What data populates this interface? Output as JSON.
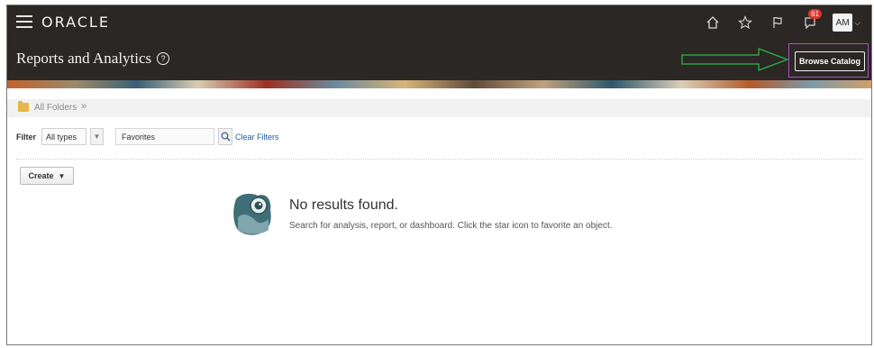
{
  "header": {
    "logo": "ORACLE",
    "page_title": "Reports and Analytics",
    "notification_count": "61",
    "avatar_initials": "AM",
    "icons": [
      "menu-icon",
      "home-icon",
      "star-icon",
      "flag-icon",
      "notifications-icon",
      "help-icon"
    ],
    "browse_catalog_label": "Browse Catalog",
    "bar_color": "#2b2724"
  },
  "breadcrumb": {
    "label": "All Folders",
    "separator": "»"
  },
  "filter": {
    "label": "Filter",
    "type_value": "All types",
    "favorites_value": "Favorites",
    "clear_label": "Clear Filters"
  },
  "toolbar": {
    "create_label": "Create"
  },
  "empty_state": {
    "title": "No results found.",
    "description": "Search for analysis, report, or dashboard. Click the star icon to favorite an object."
  },
  "annotation": {
    "arrow_color": "#2ea043",
    "highlight_color": "#b04fc6"
  }
}
